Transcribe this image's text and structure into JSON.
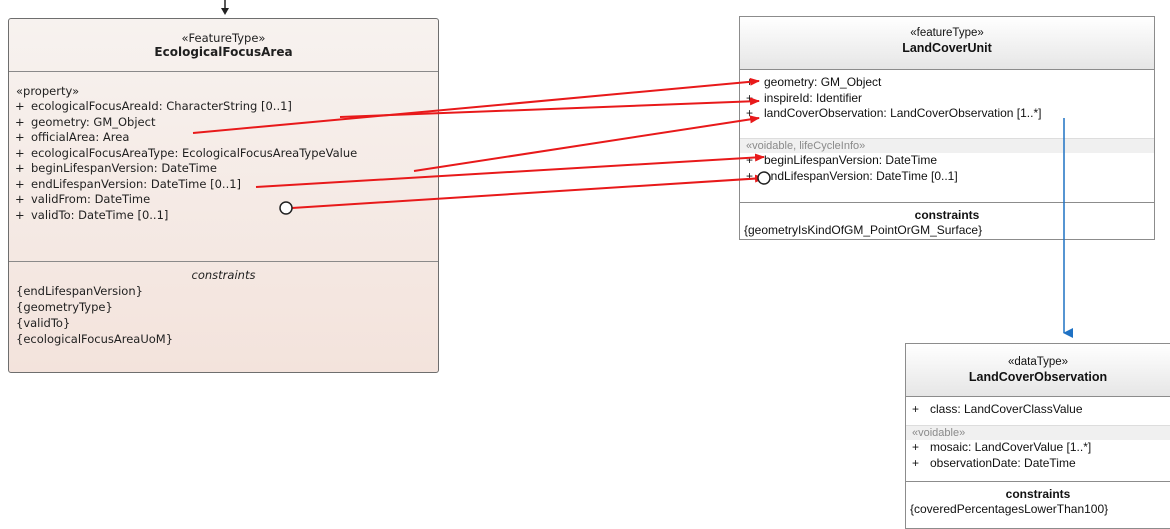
{
  "classes": {
    "ecological_focus_area": {
      "stereotype": "«FeatureType»",
      "name": "EcologicalFocusArea",
      "property_section": "«property»",
      "attributes": [
        {
          "vis": "+",
          "text": "ecologicalFocusAreaId: CharacterString [0..1]"
        },
        {
          "vis": "+",
          "text": "geometry: GM_Object"
        },
        {
          "vis": "+",
          "text": "officialArea: Area"
        },
        {
          "vis": "+",
          "text": "ecologicalFocusAreaType: EcologicalFocusAreaTypeValue"
        },
        {
          "vis": "+",
          "text": "beginLifespanVersion: DateTime"
        },
        {
          "vis": "+",
          "text": "endLifespanVersion: DateTime [0..1]"
        },
        {
          "vis": "+",
          "text": "validFrom: DateTime"
        },
        {
          "vis": "+",
          "text": "validTo: DateTime [0..1]"
        }
      ],
      "constraints_title": "constraints",
      "constraints": [
        "{endLifespanVersion}",
        "{geometryType}",
        "{validTo}",
        "{ecologicalFocusAreaUoM}"
      ]
    },
    "land_cover_unit": {
      "stereotype": "«featureType»",
      "name": "LandCoverUnit",
      "attributes": [
        {
          "vis": "+",
          "text": "geometry:  GM_Object"
        },
        {
          "vis": "+",
          "text": "inspireId:  Identifier"
        },
        {
          "vis": "+",
          "text": "landCoverObservation:  LandCoverObservation [1..*]"
        }
      ],
      "voidable_section": "«voidable, lifeCycleInfo»",
      "voidable_attributes": [
        {
          "vis": "+",
          "text": "beginLifespanVersion:  DateTime"
        },
        {
          "vis": "+",
          "text": "endLifespanVersion:  DateTime [0..1]"
        }
      ],
      "constraints_title": "constraints",
      "constraints": [
        "{geometryIsKindOfGM_PointOrGM_Surface}"
      ]
    },
    "land_cover_observation": {
      "stereotype": "«dataType»",
      "name": "LandCoverObservation",
      "attributes": [
        {
          "vis": "+",
          "text": "class:  LandCoverClassValue"
        }
      ],
      "voidable_section": "«voidable»",
      "voidable_attributes": [
        {
          "vis": "+",
          "text": "mosaic:  LandCoverValue [1..*]"
        },
        {
          "vis": "+",
          "text": "observationDate:  DateTime"
        }
      ],
      "constraints_title": "constraints",
      "constraints": [
        "{coveredPercentagesLowerThan100}"
      ]
    }
  },
  "mappings": [
    {
      "from": "ecologicalFocusAreaId",
      "to": "inspireId"
    },
    {
      "from": "geometry",
      "to": "geometry"
    },
    {
      "from": "ecologicalFocusAreaType",
      "to": "landCoverObservation"
    },
    {
      "from": "beginLifespanVersion",
      "to": "beginLifespanVersion"
    },
    {
      "from": "endLifespanVersion",
      "to": "endLifespanVersion"
    }
  ],
  "association": {
    "from": "LandCoverUnit",
    "to": "LandCoverObservation"
  },
  "colors": {
    "mapping": "#e8191a",
    "association": "#1f72c4"
  }
}
